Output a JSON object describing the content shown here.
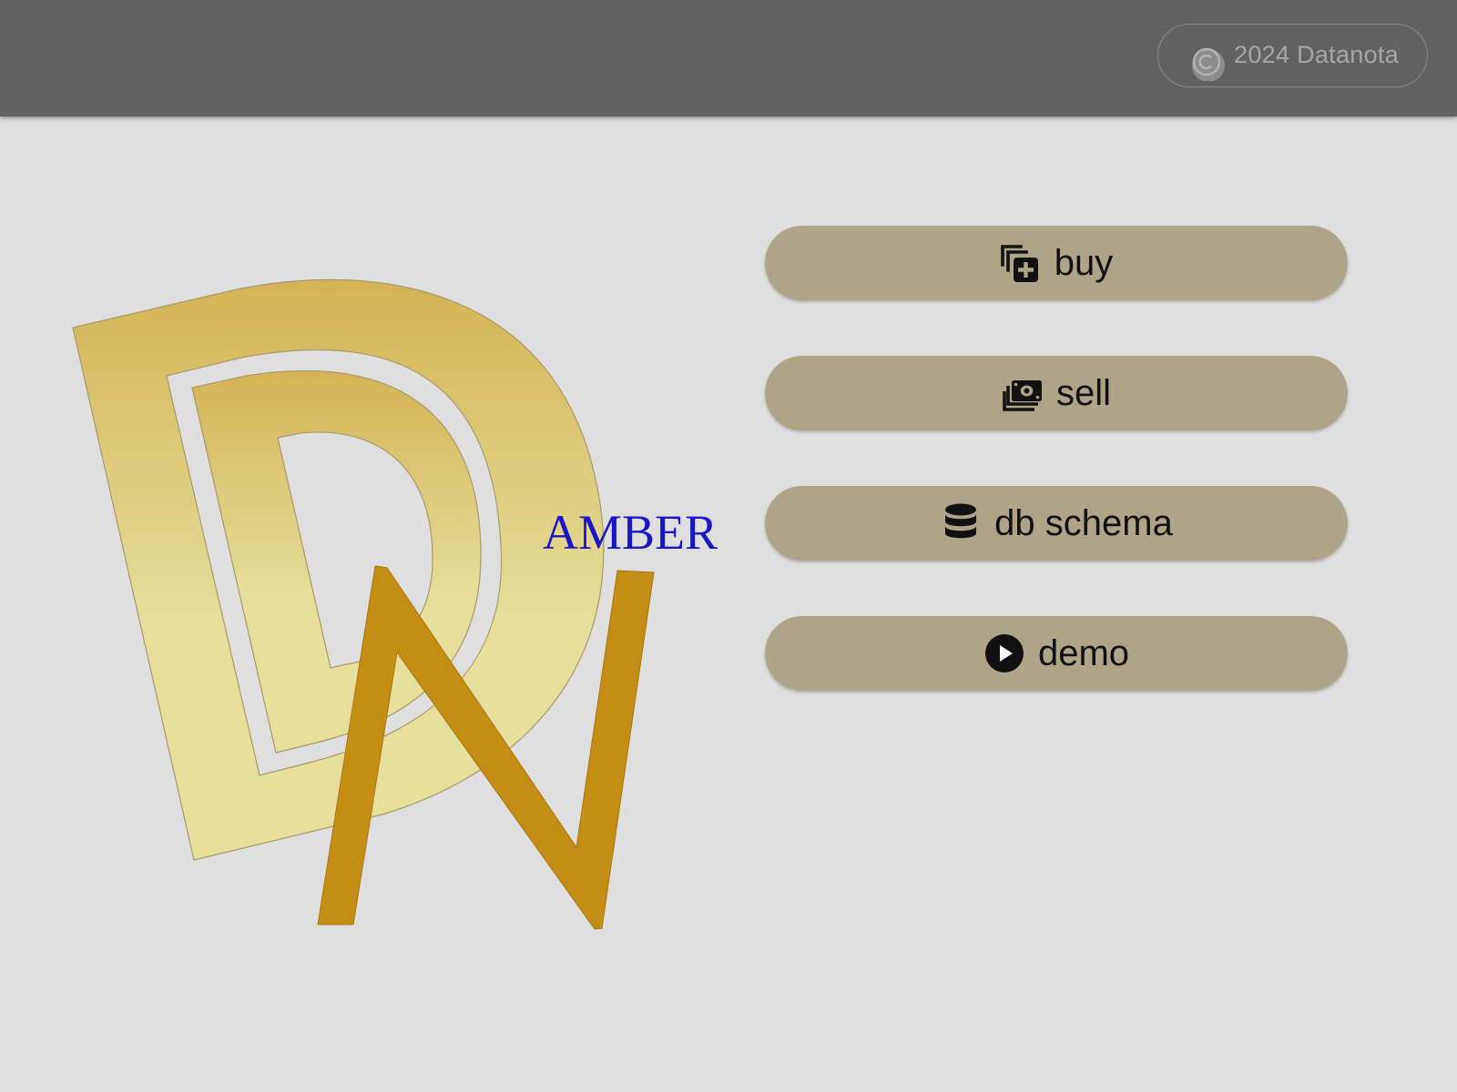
{
  "header": {
    "copyright_symbol_icon": "copyright-icon",
    "copyright_text": "2024 Datanota"
  },
  "logo": {
    "wordmark": "AMBER",
    "colors": {
      "d_gradient_top": "#d4b355",
      "d_gradient_bottom": "#e6df9c",
      "n_fill": "#c48d14",
      "wordmark": "#1a16c8"
    }
  },
  "actions": [
    {
      "label": "buy",
      "icon": "add-to-collection-icon"
    },
    {
      "label": "sell",
      "icon": "money-stack-icon"
    },
    {
      "label": "db schema",
      "icon": "database-icon"
    },
    {
      "label": "demo",
      "icon": "play-circle-icon"
    }
  ],
  "colors": {
    "topbar": "#626262",
    "background": "#dfdfdf",
    "button": "#aea586",
    "button_text": "#111111"
  }
}
